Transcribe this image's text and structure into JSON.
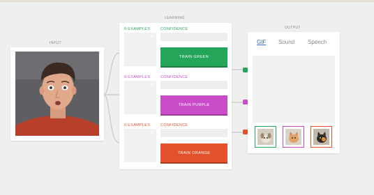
{
  "labels": {
    "input": "INPUT",
    "learning": "LEARNING",
    "output": "OUTPUT"
  },
  "classes": [
    {
      "examples": "0 EXAMPLES",
      "confidence": "CONFIDENCE",
      "button": "TRAIN GREEN",
      "color": "#25a55a",
      "shadow": "#1c7d44"
    },
    {
      "examples": "0 EXAMPLES",
      "confidence": "CONFIDENCE",
      "button": "TRAIN PURPLE",
      "color": "#c94cc8",
      "shadow": "#973995"
    },
    {
      "examples": "0 EXAMPLES",
      "confidence": "CONFIDENCE",
      "button": "TRAIN ORANGE",
      "color": "#e2532d",
      "shadow": "#a93e22"
    }
  ],
  "output": {
    "tabs": [
      "GIF",
      "Sound",
      "Speech"
    ],
    "active_tab": "GIF",
    "thumbnails": [
      "dog-gif-thumbnail",
      "kitten-gif-thumbnail",
      "cat-gif-thumbnail"
    ]
  },
  "icons": {
    "remove_example": "✕"
  },
  "colors": {
    "background": "#efefef",
    "active_tab": "#3a6fd0"
  }
}
